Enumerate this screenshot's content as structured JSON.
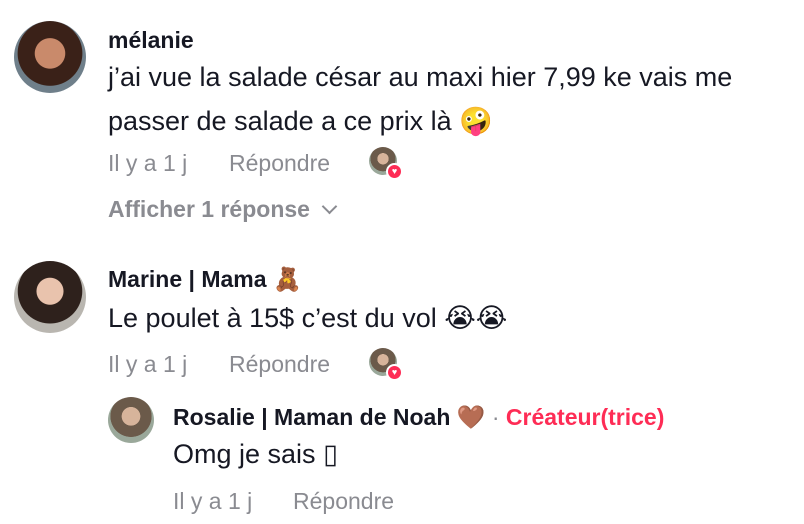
{
  "comments": [
    {
      "author": "mélanie",
      "text_line1": "j’ai vue la salade césar au maxi hier 7,99 ke vais me",
      "text_line2": "passer de salade a ce prix là",
      "text_emoji": "🤪",
      "time": "Il y a 1 j",
      "reply_label": "Répondre",
      "show_replies": "Afficher 1 réponse"
    },
    {
      "author": "Marine | Mama",
      "author_emoji": "🧸",
      "text": "Le poulet à 15$ c’est du vol",
      "text_emoji": "😭😭",
      "time": "Il y a 1 j",
      "reply_label": "Répondre",
      "reply": {
        "author": "Rosalie | Maman de Noah",
        "author_emoji": "🤎",
        "separator": "·",
        "badge": "Créateur(trice)",
        "text": "Omg je sais",
        "text_emoji": "▯",
        "time": "Il y a 1 j",
        "reply_label": "Répondre"
      }
    }
  ],
  "colors": {
    "accent": "#fe2c55",
    "muted": "#8a8b91",
    "text": "#161823"
  }
}
